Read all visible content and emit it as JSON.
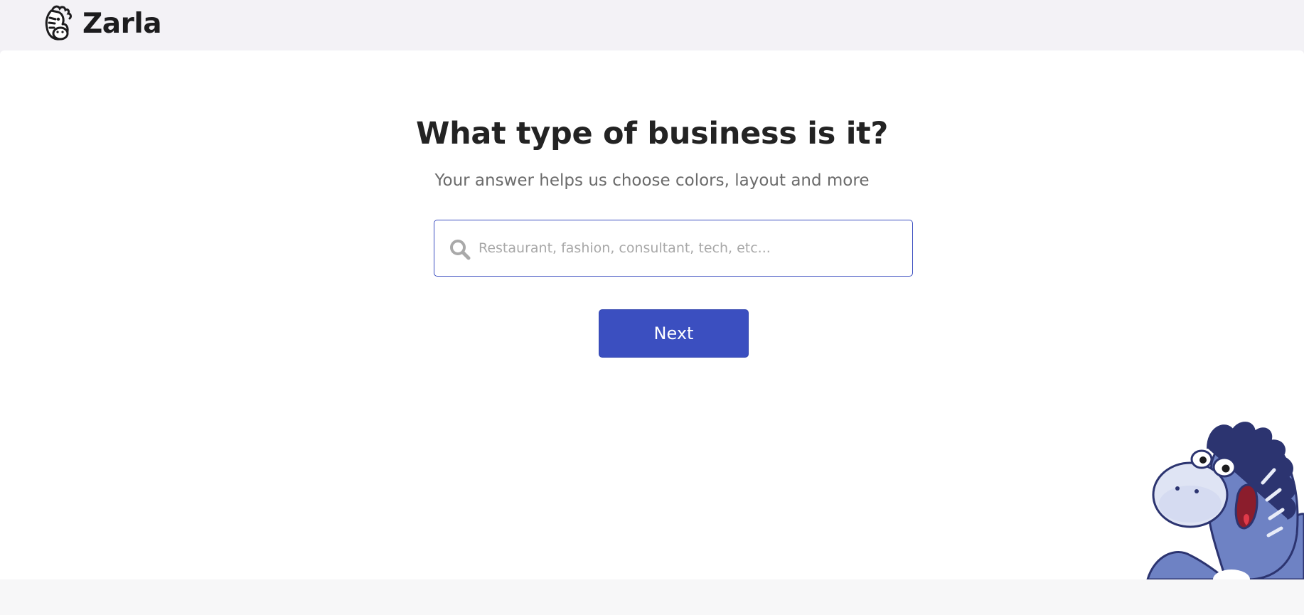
{
  "brand": {
    "name": "Zarla",
    "logo_icon": "zebra-logo-icon",
    "accent_color": "#3b4fc0"
  },
  "main": {
    "title": "What type of business is it?",
    "subtitle": "Your answer helps us choose colors, layout and more",
    "search": {
      "icon": "search-icon",
      "placeholder": "Restaurant, fashion, consultant, tech, etc...",
      "value": ""
    },
    "next_label": "Next"
  },
  "mascot": {
    "icon": "zebra-mascot-icon"
  }
}
